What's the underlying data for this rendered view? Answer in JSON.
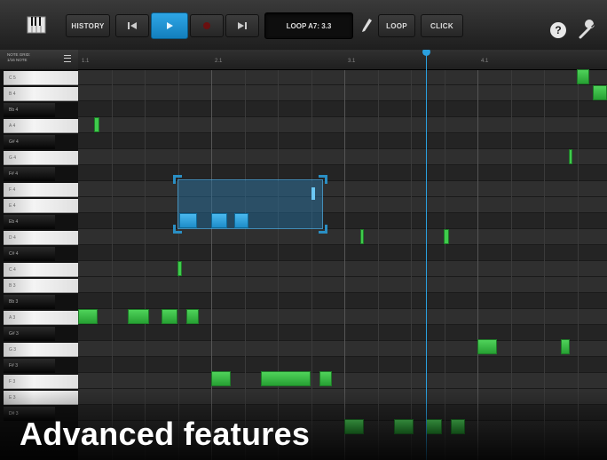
{
  "toolbar": {
    "history_label": "HISTORY",
    "loop_display": "LOOP A7: 3.3",
    "loop_label": "LOOP",
    "click_label": "CLICK",
    "help_label": "?"
  },
  "keyboard": {
    "header_line1": "NOTE GRID:",
    "header_line2": "1/16 NOTE",
    "keys": [
      {
        "label": "C 5",
        "type": "white"
      },
      {
        "label": "B 4",
        "type": "white"
      },
      {
        "label": "Bb 4",
        "type": "black"
      },
      {
        "label": "A 4",
        "type": "white"
      },
      {
        "label": "G# 4",
        "type": "black"
      },
      {
        "label": "G 4",
        "type": "white"
      },
      {
        "label": "F# 4",
        "type": "black"
      },
      {
        "label": "F 4",
        "type": "white"
      },
      {
        "label": "E 4",
        "type": "white"
      },
      {
        "label": "Eb 4",
        "type": "black"
      },
      {
        "label": "D 4",
        "type": "white"
      },
      {
        "label": "C# 4",
        "type": "black"
      },
      {
        "label": "C 4",
        "type": "white"
      },
      {
        "label": "B 3",
        "type": "white"
      },
      {
        "label": "Bb 3",
        "type": "black"
      },
      {
        "label": "A 3",
        "type": "white"
      },
      {
        "label": "G# 3",
        "type": "black"
      },
      {
        "label": "G 3",
        "type": "white"
      },
      {
        "label": "F# 3",
        "type": "black"
      },
      {
        "label": "F 3",
        "type": "white"
      },
      {
        "label": "E 3",
        "type": "white"
      },
      {
        "label": "D# 3",
        "type": "black"
      }
    ]
  },
  "ruler": {
    "bars": [
      "1.1",
      "2.1",
      "3.1",
      "4.1"
    ]
  },
  "caption": "Advanced features",
  "colors": {
    "note_green": "#3fcb4c",
    "note_selected": "#2ea6e6",
    "playhead": "#2aa0df"
  }
}
